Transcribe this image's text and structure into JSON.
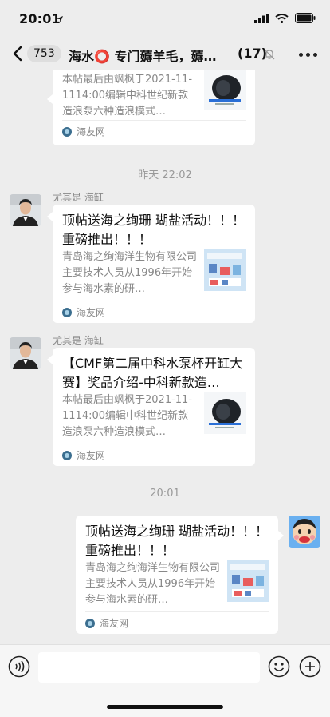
{
  "status": {
    "time": "20:01"
  },
  "nav": {
    "unread": "753",
    "title": "海水⭕ 专门薅羊毛，薅…",
    "member_count": "(17)"
  },
  "messages": [
    {
      "desc": "本帖最后由飒枫于2021-11-1114:00编辑中科世纪新款造浪泵六种造浪模式…",
      "source": "海友网"
    },
    {
      "timestamp": "昨天 22:02"
    },
    {
      "sender": "尤其是 海缸",
      "title": "顶帖送海之绚珊 瑚盐活动！！！ 重磅推出！！！",
      "desc": "青岛海之绚海洋生物有限公司主要技术人员从1996年开始参与海水素的研…",
      "source": "海友网"
    },
    {
      "sender": "尤其是 海缸",
      "title": "【CMF第二届中科水泵杯开缸大赛】奖品介绍-中科新款造…",
      "desc": "本帖最后由飒枫于2021-11-1114:00编辑中科世纪新款造浪泵六种造浪模式…",
      "source": "海友网"
    },
    {
      "timestamp": "20:01"
    },
    {
      "title": "顶帖送海之绚珊 瑚盐活动！！！ 重磅推出！！！",
      "desc": "青岛海之绚海洋生物有限公司主要技术人员从1996年开始参与海水素的研…",
      "source": "海友网"
    }
  ],
  "icons": {
    "back": "chevron-left-icon",
    "mute": "mute-bell-icon",
    "more": "more-dots-icon",
    "voice": "voice-icon",
    "emoji": "emoji-icon",
    "plus": "plus-icon"
  },
  "colors": {
    "background": "#ededed",
    "card": "#ffffff",
    "muted_text": "#888888"
  }
}
